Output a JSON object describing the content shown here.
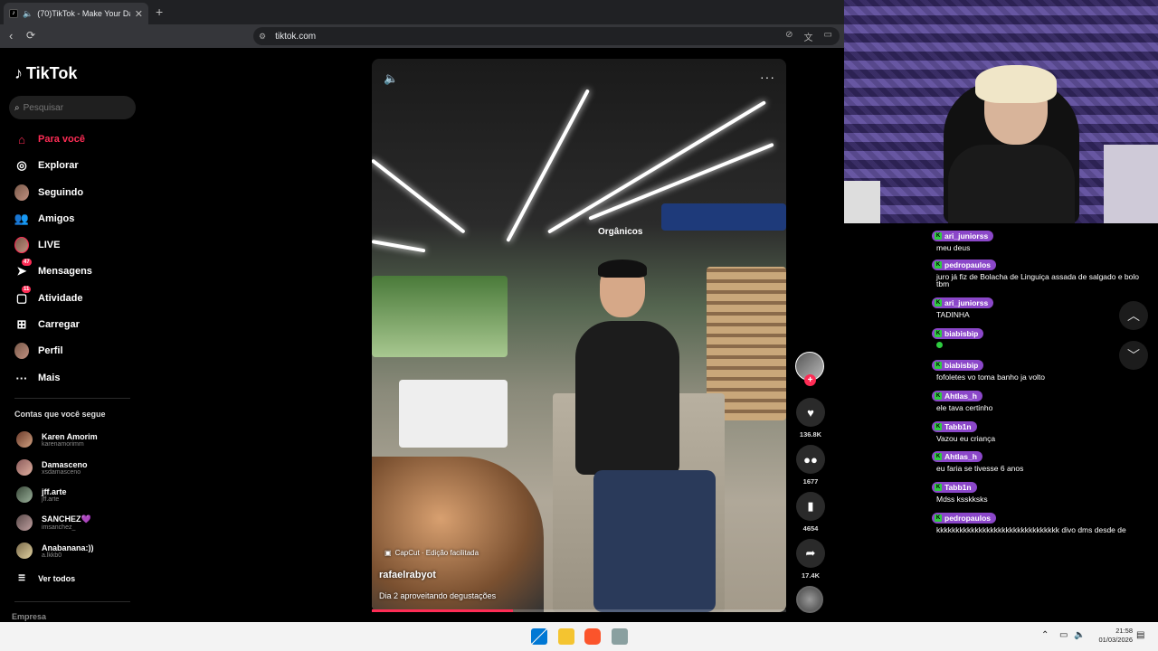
{
  "browser": {
    "tab_title": "(70)TikTok - Make Your Day",
    "tab_close": "✕",
    "new_tab": "+",
    "url": "tiktok.com"
  },
  "sidebar": {
    "logo": "TikTok",
    "search_placeholder": "Pesquisar",
    "nav": [
      {
        "label": "Para você",
        "icon": "home-icon",
        "active": true
      },
      {
        "label": "Explorar",
        "icon": "compass-icon"
      },
      {
        "label": "Seguindo",
        "icon": "following-icon"
      },
      {
        "label": "Amigos",
        "icon": "friends-icon"
      },
      {
        "label": "LIVE",
        "icon": "live-icon"
      },
      {
        "label": "Mensagens",
        "icon": "messages-icon",
        "badge": "47"
      },
      {
        "label": "Atividade",
        "icon": "activity-icon",
        "badge": "11"
      },
      {
        "label": "Carregar",
        "icon": "upload-icon"
      },
      {
        "label": "Perfil",
        "icon": "profile-icon"
      },
      {
        "label": "Mais",
        "icon": "more-icon"
      }
    ],
    "following_title": "Contas que você segue",
    "following": [
      {
        "name": "Karen Amorim",
        "handle": "karenamorimm"
      },
      {
        "name": "Damasceno",
        "handle": "xsdamasceno"
      },
      {
        "name": "jff.arte",
        "handle": "jff.arte"
      },
      {
        "name": "SANCHEZ💜",
        "handle": "imsanchez_"
      },
      {
        "name": "Anabanana:))",
        "handle": "a.lkkb0"
      }
    ],
    "see_all": "Ver todos",
    "company": "Empresa"
  },
  "video": {
    "capcut": "CapCut · Edição facilitada",
    "author": "rafaelrabyot",
    "description": "Dia 2 aproveitando degustações",
    "store_sign": "Orgânicos",
    "progress": 0.34
  },
  "actions": {
    "likes": "136.8K",
    "comments": "1677",
    "saves": "4654",
    "shares": "17.4K"
  },
  "chat": [
    {
      "user": "ari_juniorss",
      "text": "meu deus"
    },
    {
      "user": "pedropaulos",
      "text": "juro já fiz de Bolacha de Linguiça assada de salgado e bolo tbm"
    },
    {
      "user": "ari_juniorss",
      "text": "TADINHA"
    },
    {
      "user": "biabisbip",
      "text": ""
    },
    {
      "user": "biabisbip",
      "text": "fofoletes vo toma banho ja volto"
    },
    {
      "user": "Ahtlas_h",
      "text": "ele tava certinho"
    },
    {
      "user": "Tabb1n",
      "text": "Vazou eu criança"
    },
    {
      "user": "Ahtlas_h",
      "text": "eu faria se tivesse 6 anos"
    },
    {
      "user": "Tabb1n",
      "text": "Mdss ksskksks"
    },
    {
      "user": "pedropaulos",
      "text": "kkkkkkkkkkkkkkkkkkkkkkkkkkkkkkkk divo dms desde de pequeno"
    }
  ],
  "taskbar": {
    "time": "21:58",
    "date": "01/03/2026"
  },
  "colors": {
    "accent": "#fe2c55",
    "chat_user_bg": "#8b47c9",
    "kick_badge": "#2ecc40"
  }
}
